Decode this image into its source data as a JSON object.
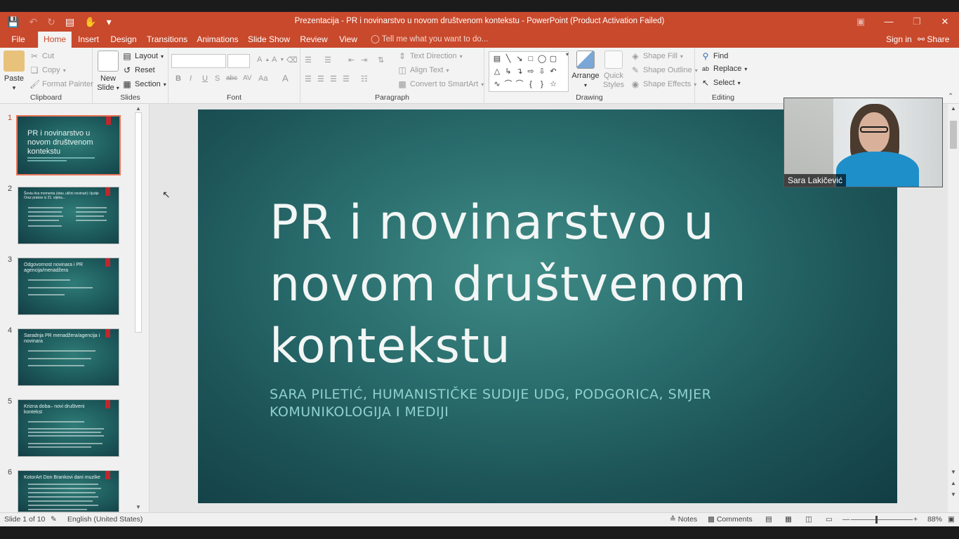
{
  "window": {
    "title": "Prezentacija - PR i novinarstvo u novom društvenom kontekstu - PowerPoint (Product Activation Failed)",
    "accent_color": "#c8492c"
  },
  "tabs": [
    "File",
    "Home",
    "Insert",
    "Design",
    "Transitions",
    "Animations",
    "Slide Show",
    "Review",
    "View"
  ],
  "tell_me": "Tell me what you want to do...",
  "sign_in": "Sign in",
  "share": "Share",
  "ribbon": {
    "clipboard": {
      "paste": "Paste",
      "cut": "Cut",
      "copy": "Copy",
      "format_painter": "Format Painter",
      "label": "Clipboard"
    },
    "slides": {
      "new_slide": "New Slide",
      "layout": "Layout",
      "reset": "Reset",
      "section": "Section",
      "label": "Slides"
    },
    "font": {
      "label": "Font",
      "bold": "B",
      "italic": "I",
      "underline": "U",
      "shadow": "S",
      "strike": "abc",
      "spacing": "AV",
      "case": "Aa",
      "color": "A",
      "grow": "A",
      "shrink": "A"
    },
    "paragraph": {
      "text_direction": "Text Direction",
      "align_text": "Align Text",
      "convert_smartart": "Convert to SmartArt",
      "label": "Paragraph"
    },
    "drawing": {
      "arrange": "Arrange",
      "quick_styles": "Quick Styles",
      "shape_fill": "Shape Fill",
      "shape_outline": "Shape Outline",
      "shape_effects": "Shape Effects",
      "label": "Drawing"
    },
    "editing": {
      "find": "Find",
      "replace": "Replace",
      "select": "Select",
      "label": "Editing"
    }
  },
  "thumbnails": [
    {
      "num": "1",
      "title": "PR i novinarstvo u novom društvenom kontekstu"
    },
    {
      "num": "2",
      "title": "Šesta dva momenta (stav, ulični novinari) i ljudje Oraz prakse iz 21. vijeka..."
    },
    {
      "num": "3",
      "title": "Odgovornost novinara i PR agencija/menadžera"
    },
    {
      "num": "4",
      "title": "Saradnja PR menadžera/agencija i novinara"
    },
    {
      "num": "5",
      "title": "Krizna doba– novi društveni kontekst"
    },
    {
      "num": "6",
      "title": "KotorArt Don Brankovi dani muzike"
    }
  ],
  "slide": {
    "title": "PR i novinarstvo u novom društvenom kontekstu",
    "subtitle": "SARA PILETIĆ, HUMANISTIČKE SUDIJE UDG, PODGORICA, SMJER KOMUNIKOLOGIJA I MEDIJI"
  },
  "video": {
    "participant": "Sara Lakičević"
  },
  "status": {
    "slide_of": "Slide 1 of 10",
    "language": "English (United States)",
    "notes": "Notes",
    "comments": "Comments",
    "zoom": "88%"
  }
}
